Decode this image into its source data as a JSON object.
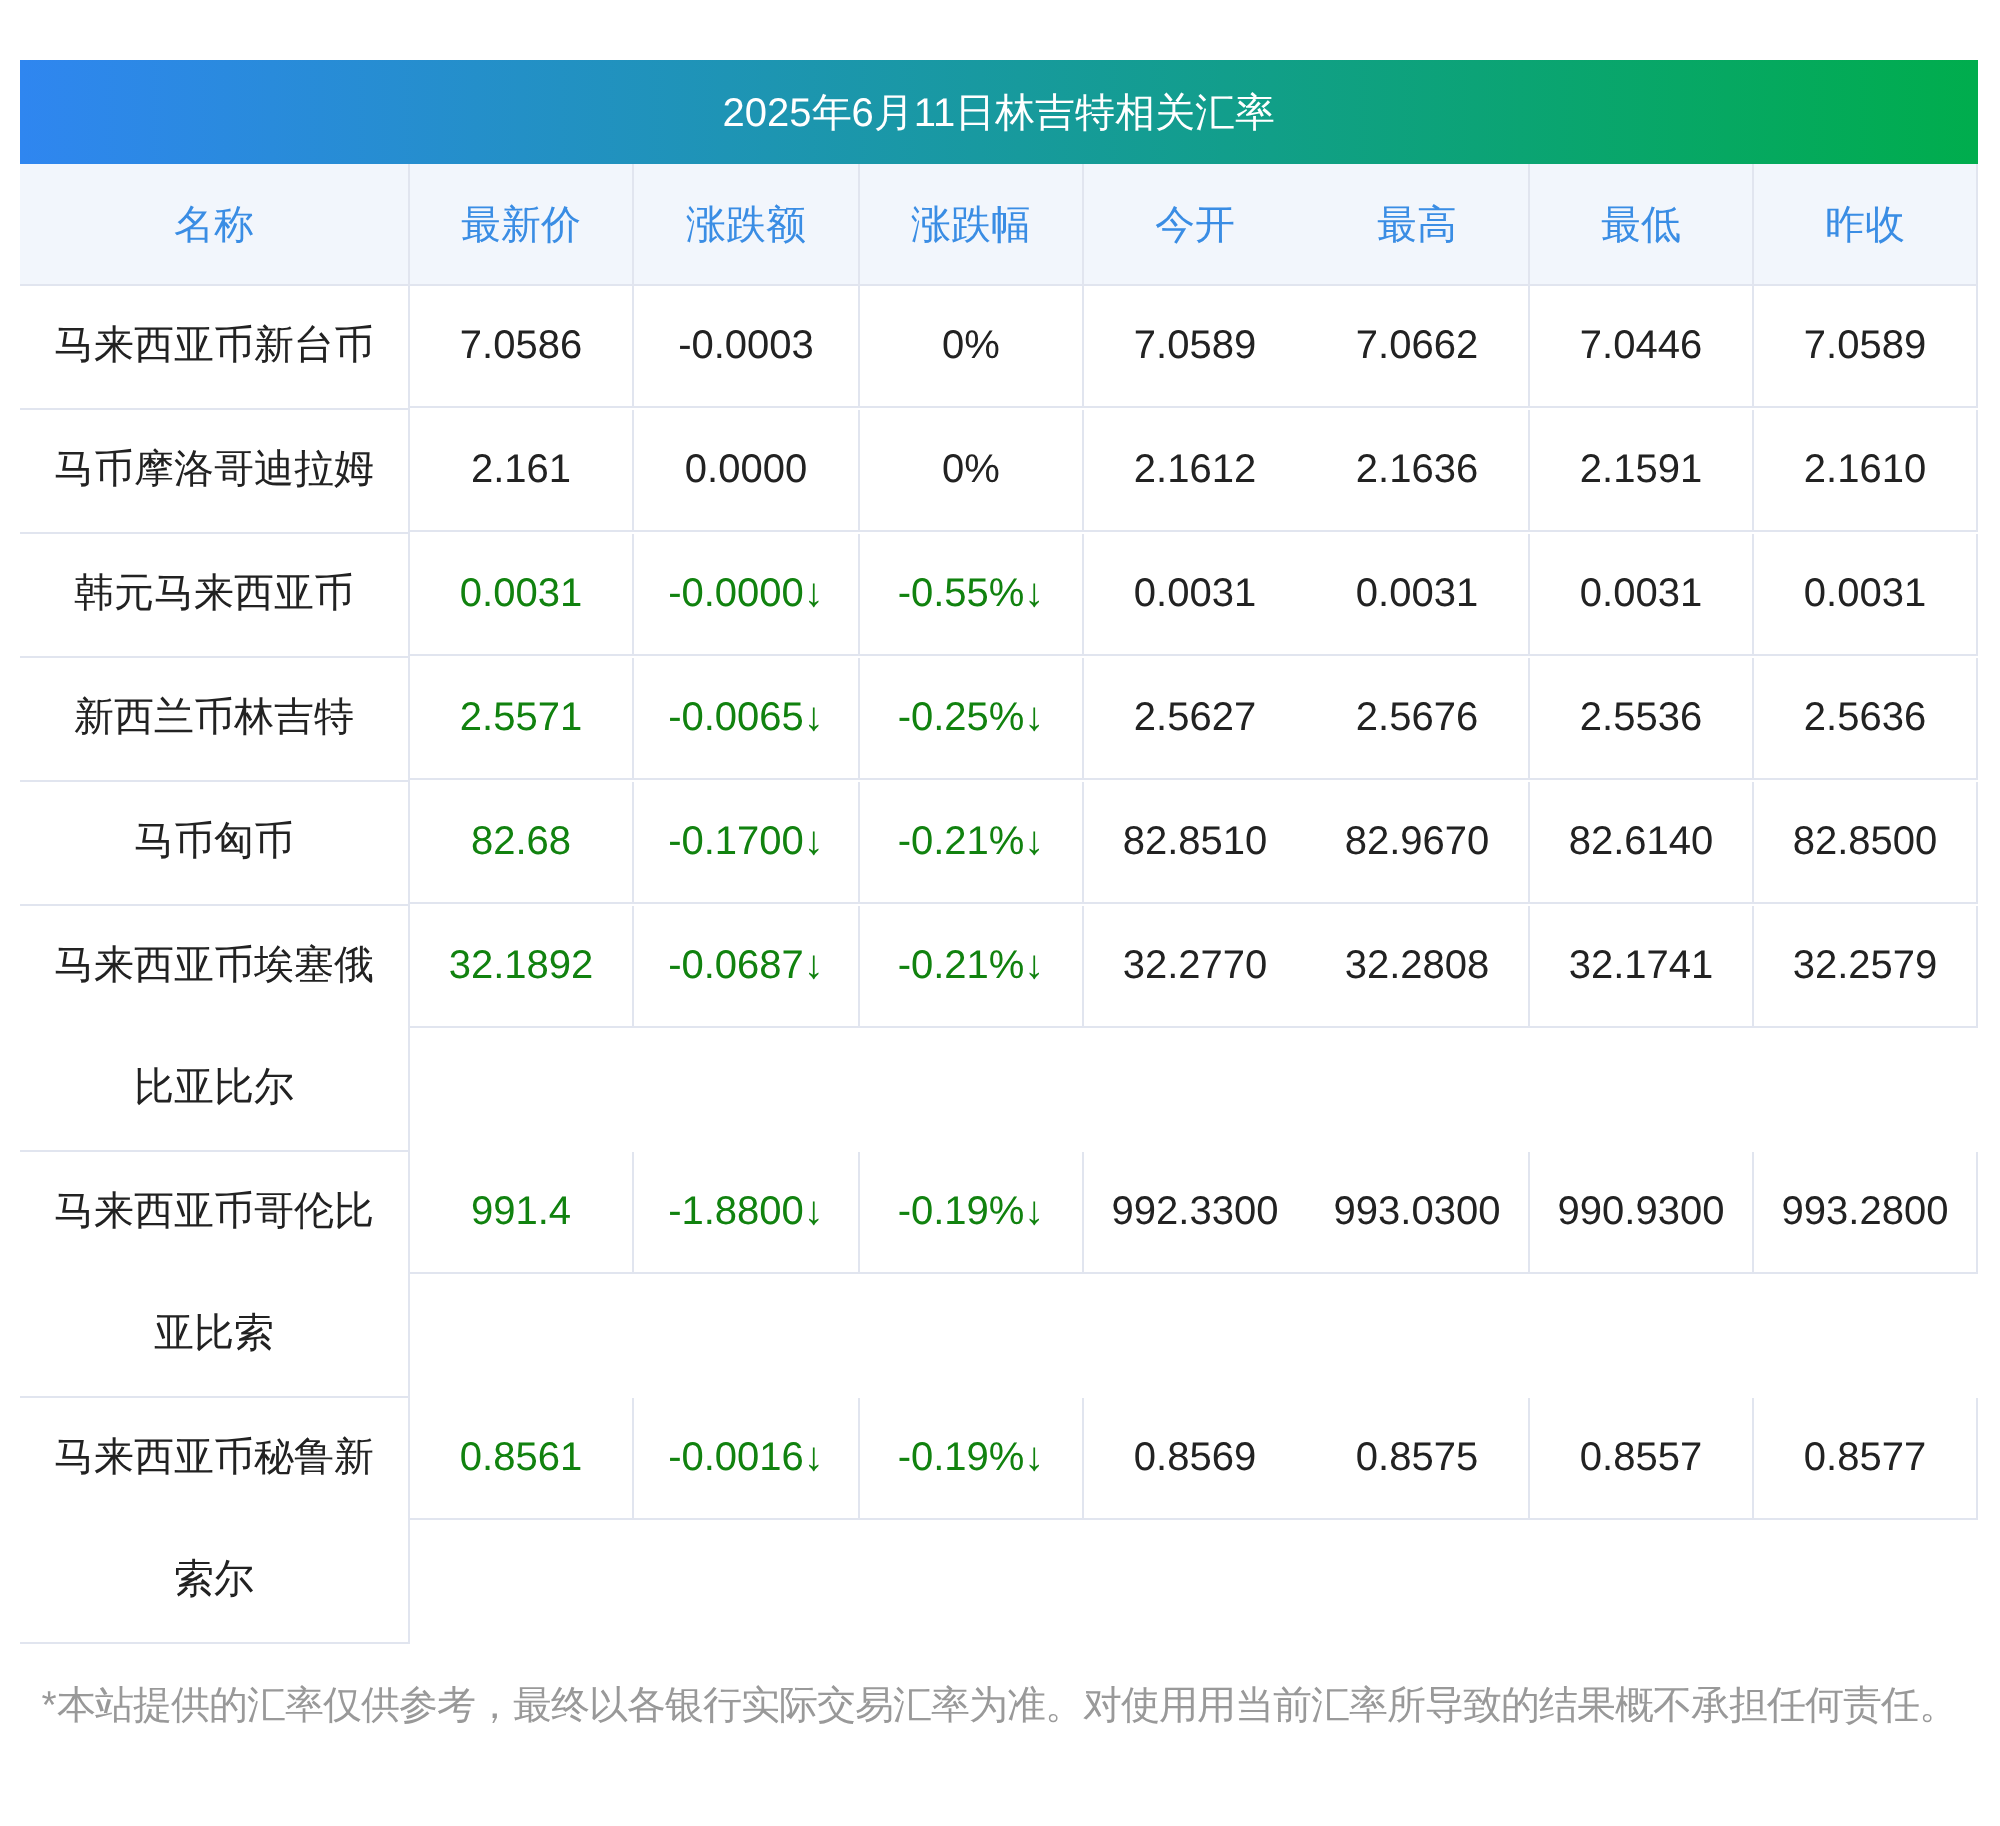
{
  "title": "2025年6月11日林吉特相关汇率",
  "columns": [
    "名称",
    "最新价",
    "涨跌额",
    "涨跌幅",
    "今开",
    "最高",
    "最低",
    "昨收"
  ],
  "rows": [
    {
      "name": "马来西亚币新台币",
      "color": "#222222",
      "values": [
        "7.0586",
        "-0.0003",
        "0%",
        "7.0589",
        "7.0662",
        "7.0446",
        "7.0589"
      ]
    },
    {
      "name": "马币摩洛哥迪拉姆",
      "color": "#222222",
      "values": [
        "2.161",
        "0.0000",
        "0%",
        "2.1612",
        "2.1636",
        "2.1591",
        "2.1610"
      ]
    },
    {
      "name": "韩元马来西亚币",
      "color": "#11820f",
      "values": [
        "0.0031",
        "-0.0000↓",
        "-0.55%↓",
        "0.0031",
        "0.0031",
        "0.0031",
        "0.0031"
      ]
    },
    {
      "name": "新西兰币林吉特",
      "color": "#11820f",
      "values": [
        "2.5571",
        "-0.0065↓",
        "-0.25%↓",
        "2.5627",
        "2.5676",
        "2.5536",
        "2.5636"
      ]
    },
    {
      "name": "马币匈币",
      "color": "#11820f",
      "values": [
        "82.68",
        "-0.1700↓",
        "-0.21%↓",
        "82.8510",
        "82.9670",
        "82.6140",
        "82.8500"
      ]
    },
    {
      "name": "马来西亚币埃塞俄比亚比尔",
      "color": "#11820f",
      "values": [
        "32.1892",
        "-0.0687↓",
        "-0.21%↓",
        "32.2770",
        "32.2808",
        "32.1741",
        "32.2579"
      ]
    },
    {
      "name": "马来西亚币哥伦比亚比索",
      "color": "#11820f",
      "values": [
        "991.4",
        "-1.8800↓",
        "-0.19%↓",
        "992.3300",
        "993.0300",
        "990.9300",
        "993.2800"
      ]
    },
    {
      "name": "马来西亚币秘鲁新索尔",
      "color": "#11820f",
      "values": [
        "0.8561",
        "-0.0016↓",
        "-0.19%↓",
        "0.8569",
        "0.8575",
        "0.8557",
        "0.8577"
      ]
    }
  ],
  "footnote": "*本站提供的汇率仅供参考，最终以各银行实际交易汇率为准。对使用用当前汇率所导致的结果概不承担任何责任。"
}
